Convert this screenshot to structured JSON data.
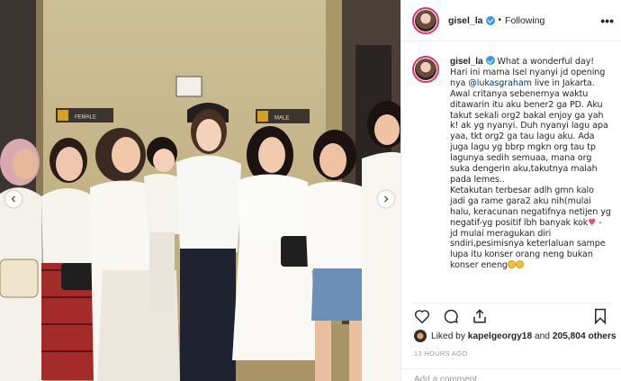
{
  "post": {
    "username": "gisel_la",
    "follow_status": "Following",
    "caption_lines": [
      "Hari ini mama Isel nyanyi jd opening",
      "live in Jakarta.",
      "Awal critanya sebenernya waktu",
      "ditawarin itu aku bener2 ga PD. Aku",
      "takut sekali org2 bakal enjoy ga yah",
      "k! ak yg nyanyi. Duh nyanyi lagu apa",
      "yaa, tkt org2 ga tau lagu aku. Ada",
      "juga lagu yg bbrp mgkn org tau tp",
      "lagunya sedih semuaa, mana org",
      "suka dengerin aku,takutnya malah",
      "pada lemes..",
      "Ketakutan terbesar adlh gmn kalo",
      "jadi ga rame gara2 aku nih(mulai",
      "halu, keracunan negatifnya netijen yg",
      "negatif-yg positif lbh banyak kok",
      "jd mulai meragukan diri",
      "sndiri,pesimisnya keterlaluan sampe",
      "lupa itu konser orang neng bukan",
      "konser eneng"
    ],
    "caption_first": "What a wonderful day!",
    "caption_nya": "nya ",
    "mention": "@lukasgraham",
    "after_heart": " -",
    "likes_prefix": "Liked by ",
    "liked_by_user": "kapelgeorgy18",
    "likes_joiner": " and ",
    "likes_count": "205,804 others",
    "timestamp": "13 HOURS AGO",
    "comment_placeholder": "Add a comment...",
    "more_icon": "•••",
    "accent": "#3897f0",
    "heart_color": "#ed4956"
  },
  "photo": {
    "left_sign": "FEMALE",
    "right_sign": "MALE"
  }
}
